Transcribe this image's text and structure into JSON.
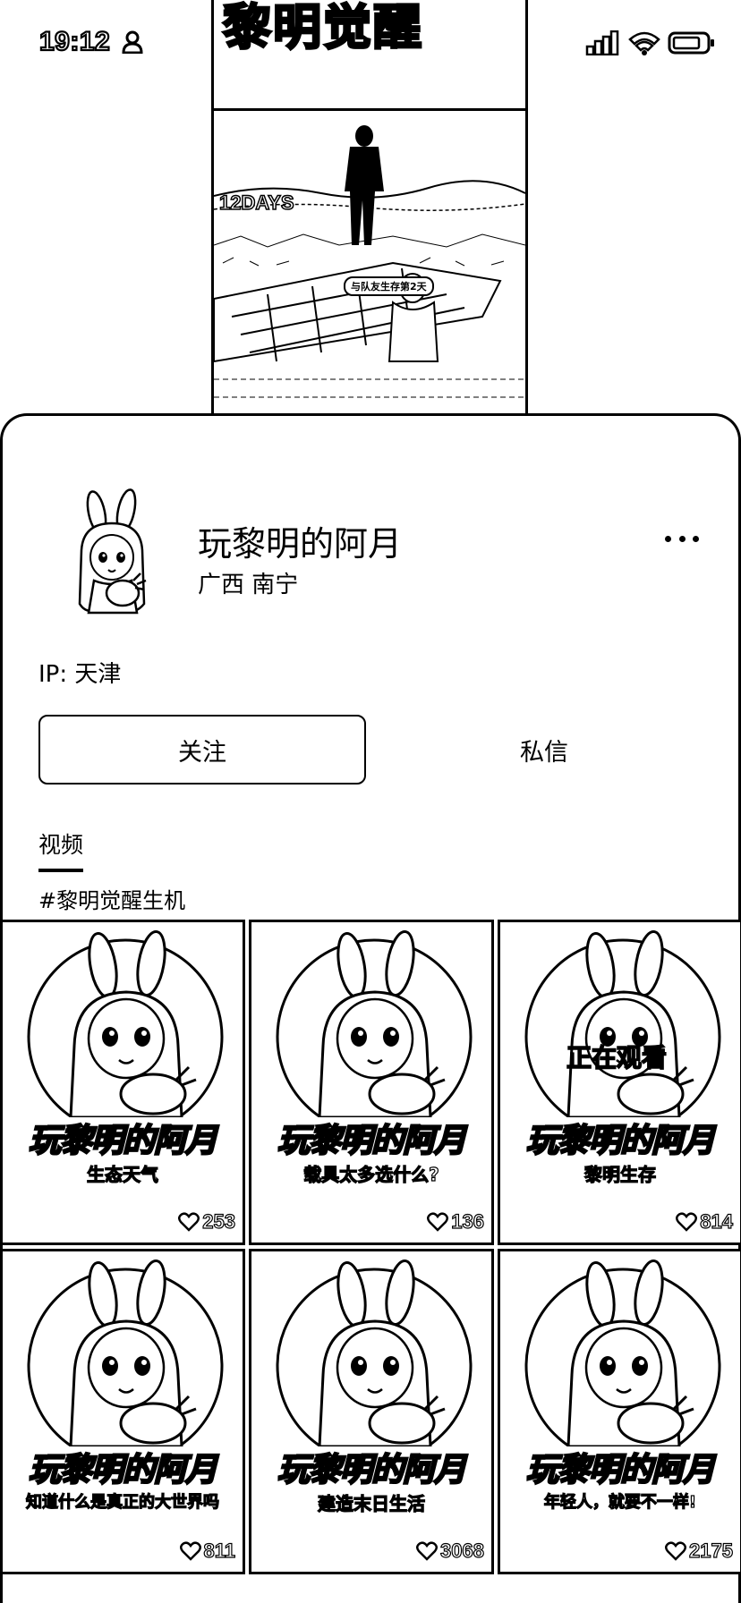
{
  "status_bar": {
    "time": "19:12",
    "icons": [
      "person-icon",
      "signal-icon",
      "wifi-icon",
      "battery-icon"
    ]
  },
  "background_video": {
    "title": "黎明觉醒",
    "badge": "12DAYS",
    "caption": "与队友生存第2天"
  },
  "profile": {
    "name": "玩黎明的阿月",
    "location": "广西 南宁",
    "ip": "IP: 天津",
    "follow_label": "关注",
    "message_label": "私信",
    "more_icon": "more-horizontal-icon"
  },
  "tabs": {
    "videos": "视频"
  },
  "hashtag": "#黎明觉醒生机",
  "videos": [
    {
      "title": "玩黎明的阿月",
      "subtitle": "生态天气",
      "likes": "253",
      "watching": ""
    },
    {
      "title": "玩黎明的阿月",
      "subtitle": "载具太多选什么?",
      "likes": "136",
      "watching": ""
    },
    {
      "title": "玩黎明的阿月",
      "subtitle": "黎明生存",
      "likes": "814",
      "watching": "正在观看"
    },
    {
      "title": "玩黎明的阿月",
      "subtitle": "知道什么是真正的大世界吗",
      "likes": "811",
      "watching": ""
    },
    {
      "title": "玩黎明的阿月",
      "subtitle": "建造末日生活",
      "likes": "3068",
      "watching": ""
    },
    {
      "title": "玩黎明的阿月",
      "subtitle": "年轻人，就要不一样!",
      "likes": "2175",
      "watching": ""
    }
  ],
  "colors": {
    "foreground": "#000000",
    "background": "#ffffff"
  }
}
